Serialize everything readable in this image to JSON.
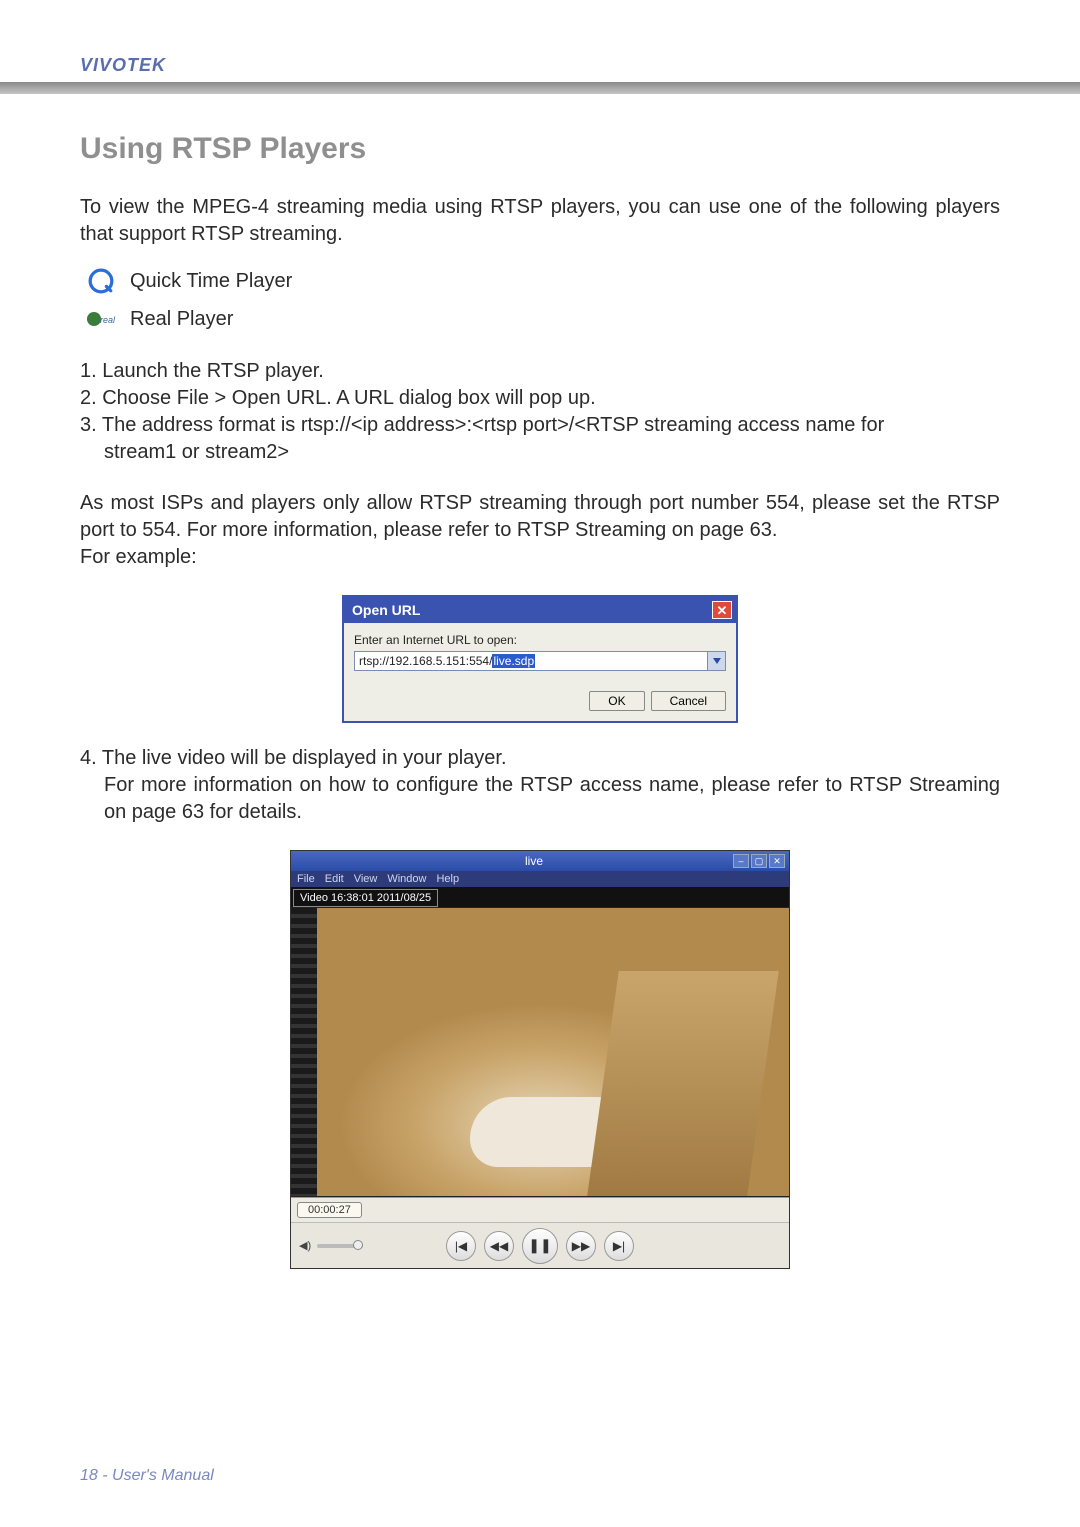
{
  "brand": "VIVOTEK",
  "section_title": "Using RTSP Players",
  "intro": "To view the MPEG-4 streaming media using RTSP players, you can use one of the following players that support RTSP streaming.",
  "players": {
    "quicktime": "Quick Time Player",
    "real": "Real Player"
  },
  "steps": {
    "s1": "1. Launch the RTSP player.",
    "s2": "2. Choose File > Open URL. A URL dialog box will pop up.",
    "s3": "3. The address format is rtsp://<ip address>:<rtsp port>/<RTSP streaming access name for stream1 or stream2>",
    "s3_wrap": "stream1 or stream2>"
  },
  "note_block": {
    "p1": "As most ISPs and players only allow RTSP streaming through port number 554, please set the RTSP port to 554. For more information, please refer to RTSP Streaming on page 63.",
    "p2": "For example:"
  },
  "dialog": {
    "title": "Open URL",
    "label": "Enter an Internet URL to open:",
    "url_prefix": "rtsp://192.168.5.151:554/",
    "url_highlight": "live.sdp",
    "ok": "OK",
    "cancel": "Cancel"
  },
  "step4": {
    "a": "4. The live video will be displayed in your player.",
    "b": "For more information on how to configure the RTSP access name, please refer to RTSP Streaming on page 63 for details."
  },
  "player_window": {
    "title": "live",
    "menus": [
      "File",
      "Edit",
      "View",
      "Window",
      "Help"
    ],
    "timestamp": "Video 16:38:01 2011/08/25",
    "elapsed": "00:00:27"
  },
  "footer": "18 - User's Manual"
}
